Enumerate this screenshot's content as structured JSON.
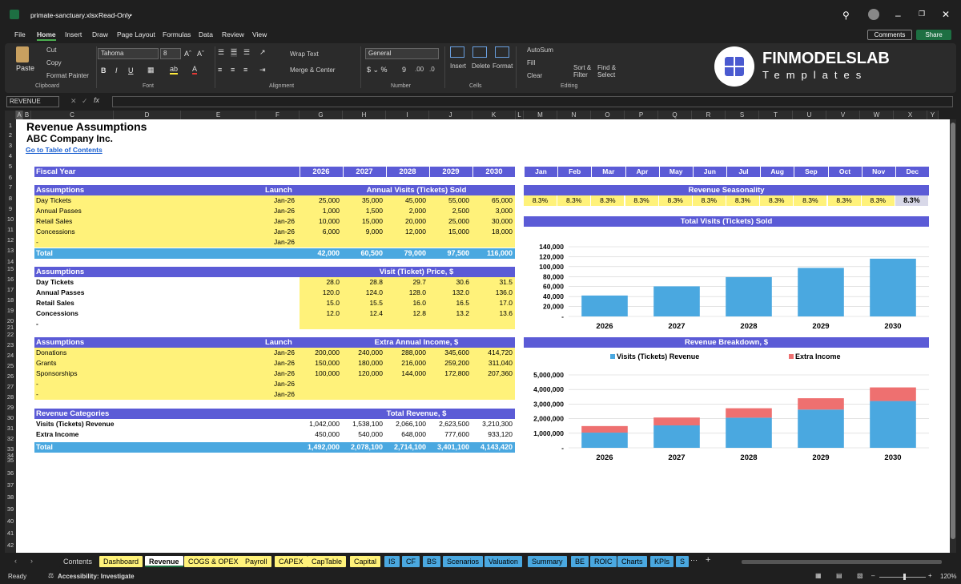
{
  "window": {
    "filename": "primate-sanctuary.xlsx",
    "mode": "Read-Only",
    "comments": "Comments",
    "share": "Share"
  },
  "menus": [
    "File",
    "Home",
    "Insert",
    "Draw",
    "Page Layout",
    "Formulas",
    "Data",
    "Review",
    "View"
  ],
  "ribbon": {
    "paste": "Paste",
    "cut": "Cut",
    "copy": "Copy",
    "format_painter": "Format Painter",
    "clipboard": "Clipboard",
    "font_name": "Tahoma",
    "font_size": "8",
    "font": "Font",
    "wrap_text": "Wrap Text",
    "merge_center": "Merge & Center",
    "alignment": "Alignment",
    "number_format": "General",
    "number": "Number",
    "insert": "Insert",
    "delete": "Delete",
    "format": "Format",
    "cells": "Cells",
    "autosum": "AutoSum",
    "fill": "Fill",
    "clear": "Clear",
    "sort_filter": "Sort & Filter",
    "find_select": "Find & Select",
    "editing": "Editing"
  },
  "brand": {
    "name": "FINMODELSLAB",
    "sub": "Templates"
  },
  "namebox": "REVENUE",
  "columns": [
    "A",
    "B",
    "C",
    "D",
    "E",
    "F",
    "G",
    "H",
    "I",
    "J",
    "K",
    "L",
    "M",
    "N",
    "O",
    "P",
    "Q",
    "R",
    "S",
    "T",
    "U",
    "V",
    "W",
    "X",
    "Y"
  ],
  "rows": [
    "1",
    "2",
    "3",
    "4",
    "5",
    "6",
    "7",
    "8",
    "9",
    "10",
    "11",
    "12",
    "13",
    "14",
    "15",
    "16",
    "17",
    "18",
    "19",
    "20",
    "21",
    "22",
    "23",
    "24",
    "25",
    "26",
    "27",
    "28",
    "29",
    "30",
    "31",
    "32",
    "33",
    "34",
    "35",
    "36",
    "37",
    "38",
    "39",
    "40",
    "41",
    "42"
  ],
  "sheet": {
    "title": "Revenue Assumptions",
    "company": "ABC Company Inc.",
    "toc_link": "Go to Table of Contents",
    "fiscal_year": "Fiscal Year",
    "years": [
      "2026",
      "2027",
      "2028",
      "2029",
      "2030"
    ],
    "months": [
      "Jan",
      "Feb",
      "Mar",
      "Apr",
      "May",
      "Jun",
      "Jul",
      "Aug",
      "Sep",
      "Oct",
      "Nov",
      "Dec"
    ],
    "visits": {
      "header": "Assumptions",
      "launch": "Launch",
      "title": "Annual Visits (Tickets) Sold",
      "rows": [
        {
          "label": "Day Tickets",
          "launch": "Jan-26",
          "values": [
            "25,000",
            "35,000",
            "45,000",
            "55,000",
            "65,000"
          ]
        },
        {
          "label": "Annual Passes",
          "launch": "Jan-26",
          "values": [
            "1,000",
            "1,500",
            "2,000",
            "2,500",
            "3,000"
          ]
        },
        {
          "label": "Retail Sales",
          "launch": "Jan-26",
          "values": [
            "10,000",
            "15,000",
            "20,000",
            "25,000",
            "30,000"
          ]
        },
        {
          "label": "Concessions",
          "launch": "Jan-26",
          "values": [
            "6,000",
            "9,000",
            "12,000",
            "15,000",
            "18,000"
          ]
        },
        {
          "label": "-",
          "launch": "Jan-26",
          "values": [
            "",
            "",
            "",
            "",
            ""
          ]
        }
      ],
      "total_label": "Total",
      "totals": [
        "42,000",
        "60,500",
        "79,000",
        "97,500",
        "116,000"
      ]
    },
    "price": {
      "header": "Assumptions",
      "title": "Visit (Ticket) Price, $",
      "rows": [
        {
          "label": "Day Tickets",
          "values": [
            "28.0",
            "28.8",
            "29.7",
            "30.6",
            "31.5"
          ]
        },
        {
          "label": "Annual Passes",
          "values": [
            "120.0",
            "124.0",
            "128.0",
            "132.0",
            "136.0"
          ]
        },
        {
          "label": "Retail Sales",
          "values": [
            "15.0",
            "15.5",
            "16.0",
            "16.5",
            "17.0"
          ]
        },
        {
          "label": "Concessions",
          "values": [
            "12.0",
            "12.4",
            "12.8",
            "13.2",
            "13.6"
          ]
        },
        {
          "label": "-",
          "values": [
            "",
            "",
            "",
            "",
            ""
          ]
        }
      ]
    },
    "extra": {
      "header": "Assumptions",
      "launch": "Launch",
      "title": "Extra Annual Income, $",
      "rows": [
        {
          "label": "Donations",
          "launch": "Jan-26",
          "values": [
            "200,000",
            "240,000",
            "288,000",
            "345,600",
            "414,720"
          ]
        },
        {
          "label": "Grants",
          "launch": "Jan-26",
          "values": [
            "150,000",
            "180,000",
            "216,000",
            "259,200",
            "311,040"
          ]
        },
        {
          "label": "Sponsorships",
          "launch": "Jan-26",
          "values": [
            "100,000",
            "120,000",
            "144,000",
            "172,800",
            "207,360"
          ]
        },
        {
          "label": "-",
          "launch": "Jan-26",
          "values": [
            "",
            "",
            "",
            "",
            ""
          ]
        },
        {
          "label": "-",
          "launch": "Jan-26",
          "values": [
            "",
            "",
            "",
            "",
            ""
          ]
        }
      ]
    },
    "revenue": {
      "header": "Revenue Categories",
      "title": "Total Revenue, $",
      "rows": [
        {
          "label": "Visits (Tickets) Revenue",
          "values": [
            "1,042,000",
            "1,538,100",
            "2,066,100",
            "2,623,500",
            "3,210,300"
          ]
        },
        {
          "label": "Extra Income",
          "values": [
            "450,000",
            "540,000",
            "648,000",
            "777,600",
            "933,120"
          ]
        }
      ],
      "total_label": "Total",
      "totals": [
        "1,492,000",
        "2,078,100",
        "2,714,100",
        "3,401,100",
        "4,143,420"
      ]
    },
    "seasonality": {
      "title": "Revenue Seasonality",
      "values": [
        "8.3%",
        "8.3%",
        "8.3%",
        "8.3%",
        "8.3%",
        "8.3%",
        "8.3%",
        "8.3%",
        "8.3%",
        "8.3%",
        "8.3%",
        "8.3%"
      ]
    }
  },
  "chart_data": [
    {
      "type": "bar",
      "title": "Total Visits (Tickets) Sold",
      "categories": [
        "2026",
        "2027",
        "2028",
        "2029",
        "2030"
      ],
      "values": [
        42000,
        60500,
        79000,
        97500,
        116000
      ],
      "ylim": [
        0,
        140000
      ],
      "yticks": [
        "140,000",
        "120,000",
        "100,000",
        "80,000",
        "60,000",
        "40,000",
        "20,000",
        "-"
      ],
      "color": "#4aa8e0"
    },
    {
      "type": "bar",
      "stacked": true,
      "title": "Revenue Breakdown, $",
      "categories": [
        "2026",
        "2027",
        "2028",
        "2029",
        "2030"
      ],
      "series": [
        {
          "name": "Visits (Tickets) Revenue",
          "values": [
            1042000,
            1538100,
            2066100,
            2623500,
            3210300
          ],
          "color": "#4aa8e0"
        },
        {
          "name": "Extra Income",
          "values": [
            450000,
            540000,
            648000,
            777600,
            933120
          ],
          "color": "#ee7070"
        }
      ],
      "ylim": [
        0,
        5000000
      ],
      "yticks": [
        "5,000,000",
        "4,000,000",
        "3,000,000",
        "2,000,000",
        "1,000,000",
        "-"
      ]
    }
  ],
  "tabs": [
    {
      "label": "Contents",
      "color": "#1f1f1f"
    },
    {
      "label": "Dashboard",
      "color": "#fff27a"
    },
    {
      "label": "Revenue",
      "color": "#ffffff"
    },
    {
      "label": "COGS & OPEX",
      "color": "#fff27a"
    },
    {
      "label": "Payroll",
      "color": "#fff27a"
    },
    {
      "label": "CAPEX",
      "color": "#fff27a"
    },
    {
      "label": "CapTable",
      "color": "#fff27a"
    },
    {
      "label": "Capital",
      "color": "#fff27a"
    },
    {
      "label": "IS",
      "color": "#4aa8e0"
    },
    {
      "label": "CF",
      "color": "#4aa8e0"
    },
    {
      "label": "BS",
      "color": "#4aa8e0"
    },
    {
      "label": "Scenarios",
      "color": "#4aa8e0"
    },
    {
      "label": "Valuation",
      "color": "#4aa8e0"
    },
    {
      "label": "Summary",
      "color": "#4aa8e0"
    },
    {
      "label": "BE",
      "color": "#4aa8e0"
    },
    {
      "label": "ROIC",
      "color": "#4aa8e0"
    },
    {
      "label": "Charts",
      "color": "#4aa8e0"
    },
    {
      "label": "KPIs",
      "color": "#4aa8e0"
    },
    {
      "label": "S",
      "color": "#4aa8e0"
    }
  ],
  "status": {
    "ready": "Ready",
    "accessibility": "Accessibility: Investigate",
    "zoom": "120%"
  }
}
